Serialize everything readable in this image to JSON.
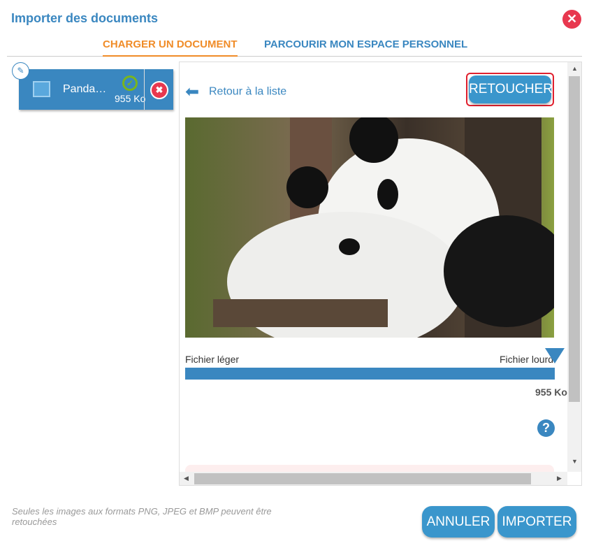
{
  "dialog": {
    "title": "Importer des documents",
    "close_icon": "close-icon"
  },
  "tabs": [
    {
      "label": "CHARGER UN DOCUMENT",
      "active": true
    },
    {
      "label": "PARCOURIR MON ESPACE PERSONNEL",
      "active": false
    }
  ],
  "file": {
    "name": "Panda…",
    "size": "955 Ko",
    "status": "uploaded"
  },
  "preview": {
    "back_label": "Retour à la liste",
    "retouch_label": "RETOUCHER",
    "light_label": "Fichier léger",
    "heavy_label": "Fichier lourd",
    "size_label": "955 Ko",
    "size_level_percent": 100
  },
  "footer": {
    "note": "Seules les images aux formats PNG, JPEG et BMP peuvent être retouchées",
    "cancel_label": "ANNULER",
    "import_label": "IMPORTER"
  },
  "colors": {
    "accent": "#3a87c0",
    "active_tab": "#f08c28",
    "danger": "#e8384f",
    "success": "#7ab51d"
  }
}
